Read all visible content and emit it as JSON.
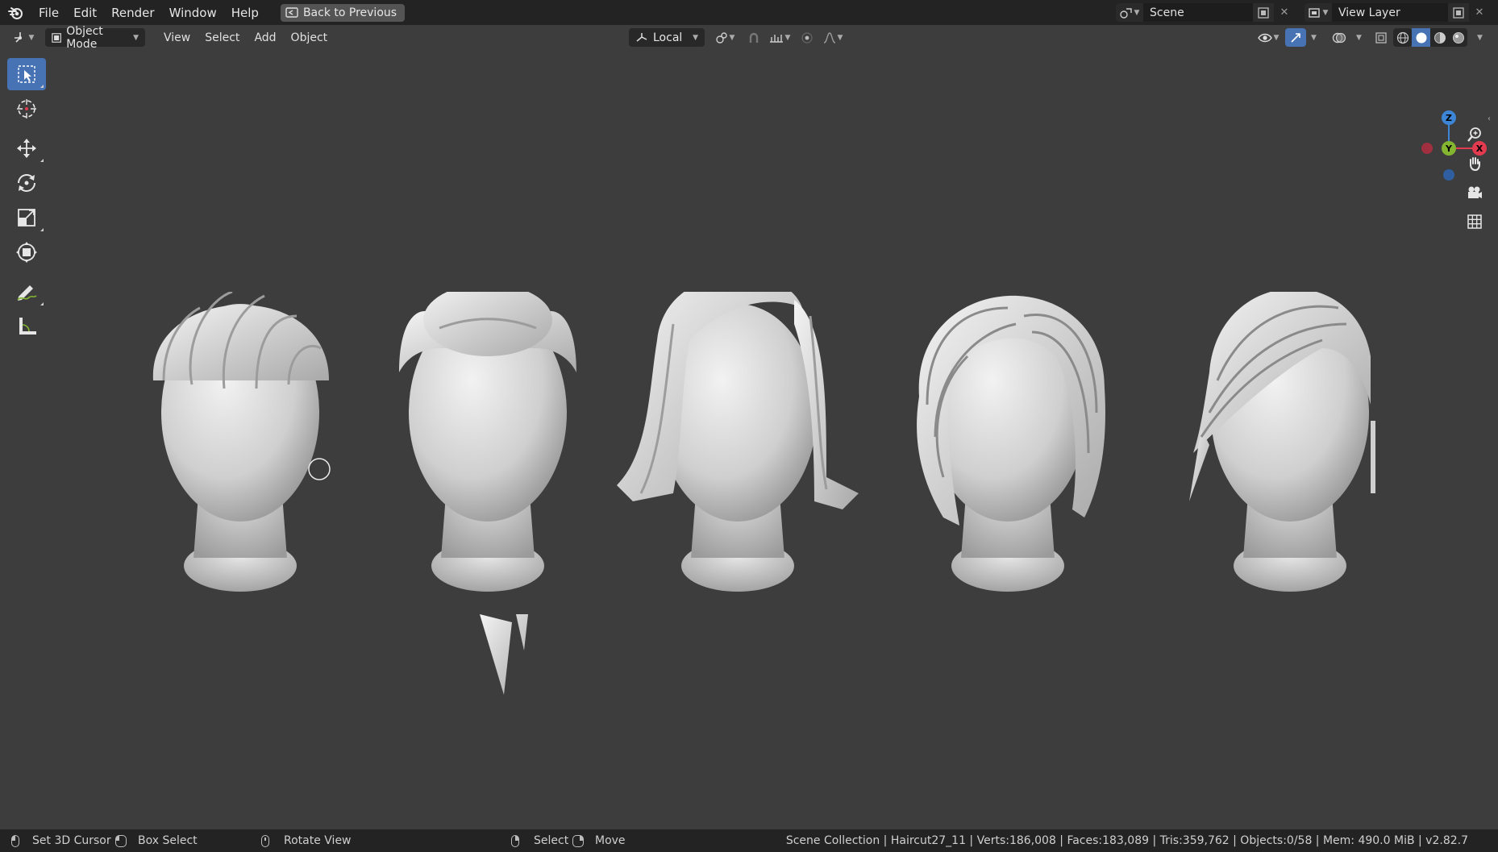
{
  "topbar": {
    "menus": [
      "File",
      "Edit",
      "Render",
      "Window",
      "Help"
    ],
    "back_button": "Back to Previous",
    "scene": "Scene",
    "view_layer": "View Layer"
  },
  "header": {
    "mode": "Object Mode",
    "menus": [
      "View",
      "Select",
      "Add",
      "Object"
    ],
    "transform_orientation": "Local"
  },
  "toolbar": {
    "tools": [
      "select-box",
      "cursor",
      "move",
      "rotate",
      "scale",
      "transform",
      "annotate",
      "measure"
    ]
  },
  "gizmo": {
    "x": "X",
    "y": "Y",
    "z": "Z"
  },
  "statusbar": {
    "hints": [
      "Set 3D Cursor",
      "Box Select",
      "Rotate View",
      "Select",
      "Move"
    ],
    "stats": "Scene Collection | Haircut27_11 | Verts:186,008 | Faces:183,089 | Tris:359,762 | Objects:0/58 | Mem: 490.0 MiB | v2.82.7"
  },
  "colors": {
    "accent": "#4772b3",
    "axis_x": "#e23b4f",
    "axis_y": "#83b531",
    "axis_z": "#3d85d7"
  }
}
